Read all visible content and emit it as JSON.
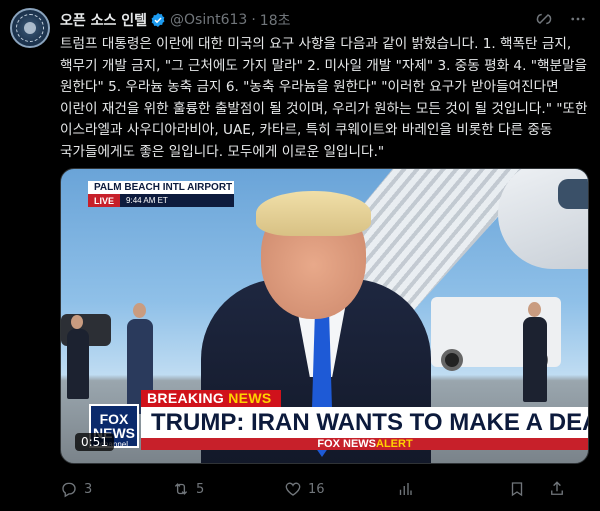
{
  "post": {
    "author_name": "오픈 소스 인텔",
    "handle": "@Osint613",
    "separator": "·",
    "time": "18초",
    "text": "트럼프 대통령은 이란에 대한 미국의 요구 사항을 다음과 같이 밝혔습니다. 1. 핵폭탄 금지, 핵무기 개발 금지, \"그 근처에도 가지 말라\" 2. 미사일 개발 \"자제\" 3. 중동 평화 4. \"핵분말을 원한다\" 5. 우라늄 농축 금지 6. \"농축 우라늄을 원한다\" \"이러한 요구가 받아들여진다면 이란이 재건을 위한 훌륭한 출발점이 될 것이며, 우리가 원하는 모든 것이 될 것입니다.\" \"또한 이스라엘과 사우디아라비아, UAE, 카타르, 특히 쿠웨이트와 바레인을 비롯한 다른 중동 국가들에게도 좋은 일입니다. 모두에게 이로운 일입니다.\""
  },
  "video": {
    "location": "PALM BEACH INTL AIRPORT",
    "live": "LIVE",
    "live_time": "9:44 AM ET",
    "breaking_1": "BREAKING ",
    "breaking_2": "NEWS",
    "logo_line1": "FOX",
    "logo_line2": "NEWS",
    "logo_line3": "channel",
    "headline": "TRUMP: IRAN WANTS TO MAKE A DEAL",
    "alert_1": "FOX NEWS",
    "alert_2": "ALERT",
    "duration": "0:51"
  },
  "actions": {
    "replies": "3",
    "reposts": "5",
    "likes": "16"
  },
  "icons": {
    "verified": "verified-badge-icon",
    "grok": "grok-icon",
    "more": "more-icon",
    "reply": "reply-icon",
    "repost": "repost-icon",
    "like": "like-icon",
    "views": "views-icon",
    "bookmark": "bookmark-icon",
    "share": "share-icon"
  },
  "colors": {
    "background": "#000000",
    "text": "#e7e9ea",
    "muted": "#71767b",
    "verified": "#1d9bf0",
    "fox_red": "#c7202a",
    "fox_navy": "#0c1a3c"
  }
}
